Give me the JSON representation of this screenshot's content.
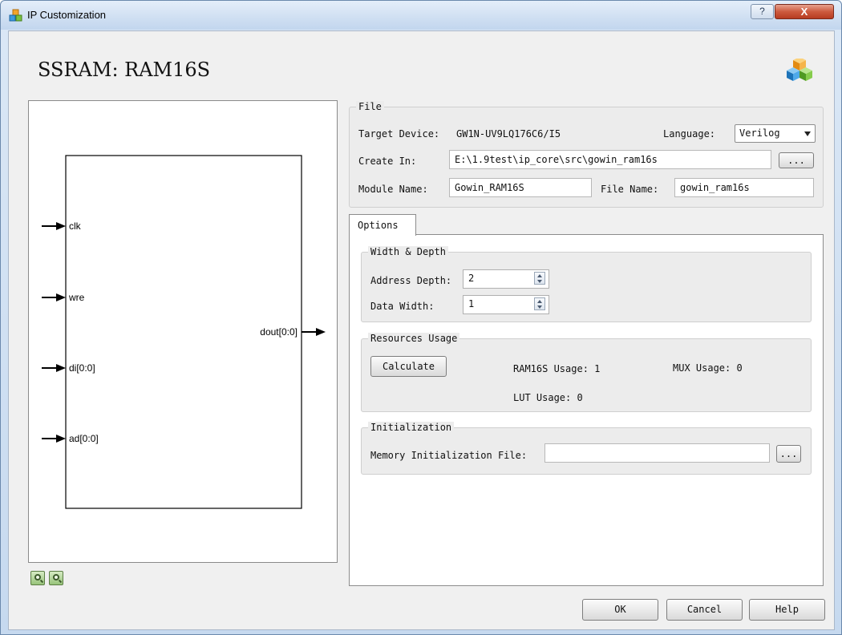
{
  "window": {
    "title": "IP Customization",
    "help_label": "?",
    "close_label": "X"
  },
  "header": {
    "title": "SSRAM: RAM16S"
  },
  "diagram": {
    "inputs": [
      "clk",
      "wre",
      "di[0:0]",
      "ad[0:0]"
    ],
    "output": "dout[0:0]"
  },
  "file_group": {
    "title": "File",
    "target_device_label": "Target Device:",
    "target_device_value": "GW1N-UV9LQ176C6/I5",
    "language_label": "Language:",
    "language_value": "Verilog",
    "create_in_label": "Create In:",
    "create_in_value": "E:\\1.9test\\ip_core\\src\\gowin_ram16s",
    "browse_label": "...",
    "module_name_label": "Module Name:",
    "module_name_value": "Gowin_RAM16S",
    "file_name_label": "File Name:",
    "file_name_value": "gowin_ram16s"
  },
  "options_tab": {
    "label": "Options"
  },
  "width_depth": {
    "title": "Width & Depth",
    "address_depth_label": "Address Depth:",
    "address_depth_value": "2",
    "data_width_label": "Data Width:",
    "data_width_value": "1"
  },
  "resources": {
    "title": "Resources Usage",
    "calculate_label": "Calculate",
    "ram16s_usage": "RAM16S Usage: 1",
    "mux_usage": "MUX Usage: 0",
    "lut_usage": "LUT Usage: 0"
  },
  "initialization": {
    "title": "Initialization",
    "mem_init_label": "Memory Initialization File:",
    "mem_init_value": "",
    "browse_label": "..."
  },
  "footer": {
    "ok_label": "OK",
    "cancel_label": "Cancel",
    "help_label": "Help"
  }
}
